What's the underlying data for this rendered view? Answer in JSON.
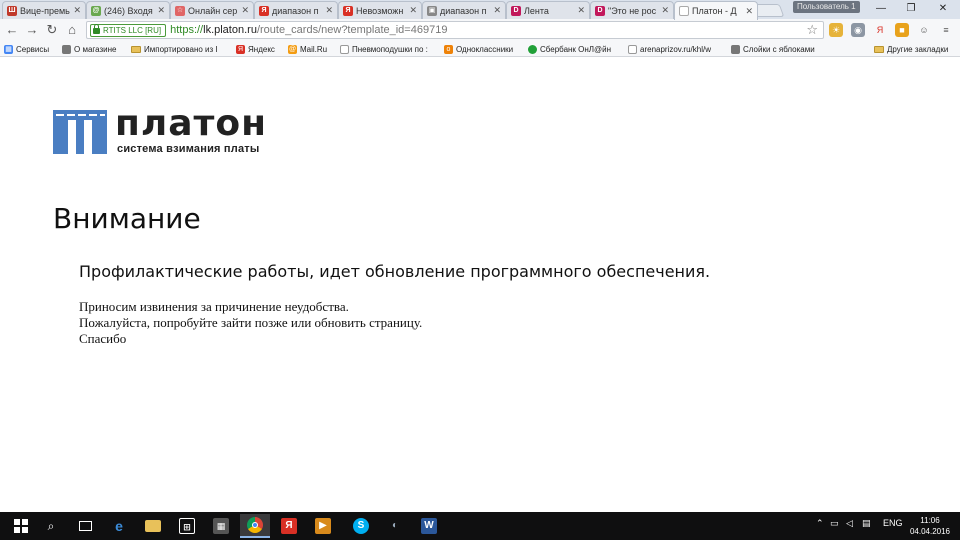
{
  "tabs": [
    {
      "title": "Вице-премь",
      "favicon": "#c0392b",
      "favicon_label": "Ш"
    },
    {
      "title": "(246) Входя",
      "favicon": "#6aa84f",
      "favicon_label": "@"
    },
    {
      "title": "Онлайн сер",
      "favicon": "#e06666",
      "favicon_label": "☆"
    },
    {
      "title": "диапазон п",
      "favicon": "#d93025",
      "favicon_label": "Я"
    },
    {
      "title": "Невозможн",
      "favicon": "#d93025",
      "favicon_label": "Я"
    },
    {
      "title": "диапазон п",
      "favicon": "#888888",
      "favicon_label": "▣"
    },
    {
      "title": "Лента",
      "favicon": "#c2185b",
      "favicon_label": "D"
    },
    {
      "title": "\"Это не рос",
      "favicon": "#c2185b",
      "favicon_label": "D"
    },
    {
      "title": "Платон - Д",
      "favicon": "#ffffff",
      "favicon_label": ""
    }
  ],
  "user_badge": "Пользователь 1",
  "window_controls": {
    "minimize": "—",
    "maximize": "❐",
    "close": "✕"
  },
  "address": {
    "cert_label": "RTITS LLC [RU]",
    "scheme": "https://",
    "host": "lk.platon.ru",
    "path": "/route_cards/new?template_id=469719"
  },
  "bookmarks": [
    {
      "label": "Сервисы",
      "kind": "apps"
    },
    {
      "label": "О магазине",
      "kind": "icon",
      "color": "#777777"
    },
    {
      "label": "Импортировано из I",
      "kind": "folder"
    },
    {
      "label": "Яндекс",
      "kind": "icon",
      "color": "#d93025",
      "glyph": "Я"
    },
    {
      "label": "Mail.Ru",
      "kind": "icon",
      "color": "#f39c12",
      "glyph": "@"
    },
    {
      "label": "Пневмоподушки по :",
      "kind": "icon",
      "color": "#999999"
    },
    {
      "label": "Одноклассники",
      "kind": "icon",
      "color": "#ee8208",
      "glyph": "о"
    },
    {
      "label": "Сбербанк ОнЛ@йн",
      "kind": "icon",
      "color": "#21a038"
    },
    {
      "label": "arenaprizov.ru/khl/w",
      "kind": "icon",
      "color": "#999999"
    },
    {
      "label": "Слойки с яблоками",
      "kind": "icon",
      "color": "#777777"
    },
    {
      "label": "Другие закладки",
      "kind": "folder"
    }
  ],
  "page": {
    "logo_word": "платон",
    "logo_sub": "система взимания платы",
    "heading": "Внимание",
    "notice": "Профилактические работы, идет обновление программного обеспечения.",
    "lines": [
      "Приносим извинения за причинение неудобства.",
      "Пожалуйста, попробуйте зайти позже или обновить страницу.",
      "Спасибо"
    ]
  },
  "taskbar": {
    "language": "ENG",
    "time": "11:06",
    "date": "04.04.2016"
  },
  "colors": {
    "logo_blue": "#4a7ec2",
    "secure_green": "#2f8a25"
  }
}
